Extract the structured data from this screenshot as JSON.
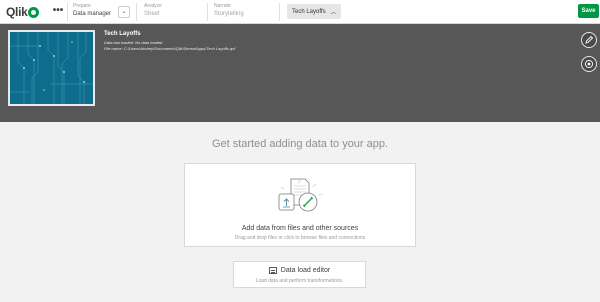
{
  "header": {
    "logo_text": "Qlik",
    "nav": [
      {
        "small": "Prepare",
        "big": "Data manager"
      },
      {
        "small": "Analyze",
        "big": "Sheet"
      },
      {
        "small": "Narrate",
        "big": "Storytelling"
      }
    ],
    "sheet_selector": "Tech Layoffs",
    "save_label": "Save"
  },
  "app": {
    "title": "Tech Layoffs",
    "last_loaded": "Data last loaded: No data loaded",
    "file_name": "File name: C:\\Users\\Andrey\\Documents\\Qlik\\Sense\\Apps\\Tech Layoffs.qvf"
  },
  "main": {
    "heading": "Get started adding data to your app.",
    "add_data_title": "Add data from files and other sources",
    "add_data_sub": "Drag and drop files or click to browse files and connections",
    "editor_title": "Data load editor",
    "editor_sub": "Load data and perform transformations."
  },
  "colors": {
    "accent": "#009845",
    "banner": "#575757",
    "thumbnail": "#0e6d8c"
  }
}
